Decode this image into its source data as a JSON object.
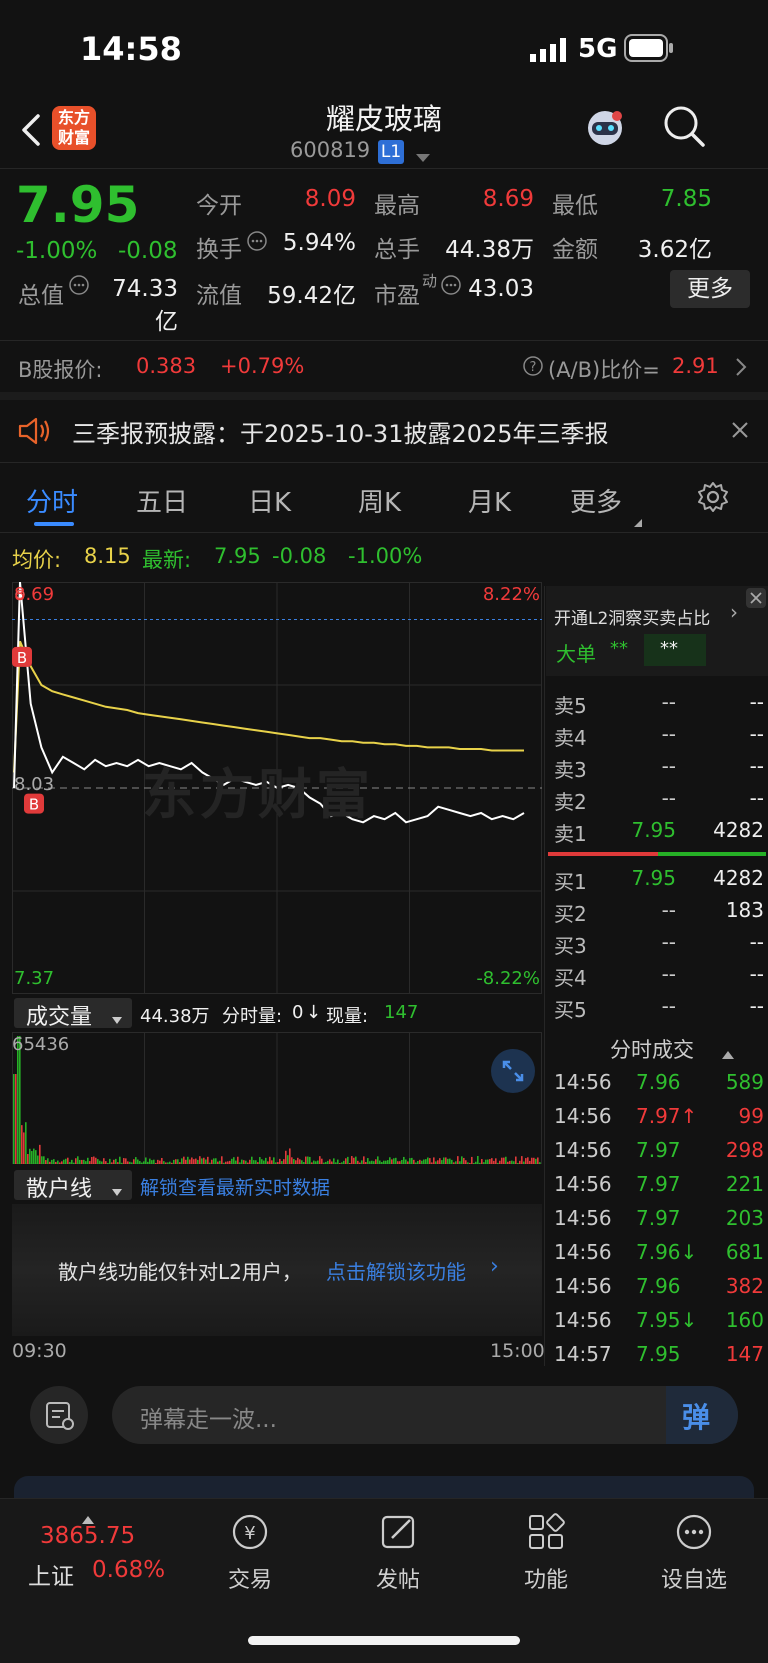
{
  "status": {
    "time": "14:58",
    "network": "5G"
  },
  "header": {
    "title": "耀皮玻璃",
    "code": "600819",
    "level": "L1",
    "logo_line1": "东方",
    "logo_line2": "财富"
  },
  "quote": {
    "price": "7.95",
    "change_pct": "-1.00%",
    "change": "-0.08",
    "row1": [
      {
        "label": "今开",
        "value": "8.09"
      },
      {
        "label": "最高",
        "value": "8.69"
      },
      {
        "label": "最低",
        "value": "7.85"
      }
    ],
    "row2": [
      {
        "label": "换手",
        "value": "5.94%"
      },
      {
        "label": "总手",
        "value": "44.38万"
      },
      {
        "label": "金额",
        "value": "3.62亿"
      }
    ],
    "row3": [
      {
        "label": "总值",
        "value": "74.33亿"
      },
      {
        "label": "流值",
        "value": "59.42亿"
      },
      {
        "label": "市盈",
        "sup": "动",
        "value": "43.03"
      }
    ],
    "more_button": "更多"
  },
  "b_share": {
    "label": "B股报价:",
    "price": "0.383",
    "change": "+0.79%",
    "ratio_label": "(A/B)比价=",
    "ratio": "2.91"
  },
  "notice": {
    "text": "三季报预披露：于2025-10-31披露2025年三季报"
  },
  "tabs": [
    "分时",
    "五日",
    "日K",
    "周K",
    "月K",
    "更多"
  ],
  "chart_header": {
    "avg_label": "均价:",
    "avg": "8.15",
    "latest_label": "最新:",
    "latest": "7.95",
    "change": "-0.08",
    "change_pct": "-1.00%"
  },
  "chart_data": {
    "type": "line",
    "y_left_ticks": [
      "8.69",
      "8.03",
      "7.37"
    ],
    "y_right_ticks": [
      "8.22%",
      "-8.22%"
    ],
    "ylim": [
      7.37,
      8.69
    ],
    "x_ticks": [
      "09:30",
      "15:00"
    ],
    "series": [
      {
        "name": "最新",
        "color": "#ffffff",
        "values": [
          8.03,
          8.69,
          8.3,
          8.16,
          8.08,
          8.13,
          8.11,
          8.09,
          8.12,
          8.1,
          8.11,
          8.1,
          8.12,
          8.1,
          8.11,
          8.1,
          8.09,
          8.11,
          8.08,
          8.06,
          8.04,
          8.06,
          8.05,
          8.04,
          8.05,
          8.03,
          8.04,
          8.03,
          8.0,
          7.98,
          7.94,
          7.95,
          7.93,
          7.92,
          7.94,
          7.93,
          7.95,
          7.92,
          7.93,
          7.94,
          7.97,
          7.96,
          7.95,
          7.94,
          7.95,
          7.93,
          7.94,
          7.93,
          7.95
        ]
      },
      {
        "name": "均价",
        "color": "#e8d24a",
        "values": [
          8.08,
          8.5,
          8.42,
          8.36,
          8.34,
          8.33,
          8.32,
          8.31,
          8.3,
          8.29,
          8.285,
          8.28,
          8.27,
          8.265,
          8.26,
          8.255,
          8.25,
          8.245,
          8.24,
          8.235,
          8.23,
          8.225,
          8.22,
          8.215,
          8.21,
          8.205,
          8.2,
          8.195,
          8.19,
          8.19,
          8.185,
          8.18,
          8.18,
          8.175,
          8.175,
          8.17,
          8.17,
          8.165,
          8.165,
          8.16,
          8.16,
          8.16,
          8.155,
          8.155,
          8.155,
          8.15,
          8.15,
          8.15,
          8.15
        ]
      }
    ],
    "markers": [
      {
        "label": "B",
        "index": 1
      },
      {
        "label": "B",
        "index": 3
      }
    ],
    "volume": {
      "label": "成交量",
      "total": "44.38万",
      "period_label": "分时量:",
      "period": "0",
      "now_label": "现量:",
      "now": "147",
      "max_tick": "65436"
    }
  },
  "watermark": "东方财富",
  "retail_line": {
    "label": "散户线",
    "unlock_link": "解锁查看最新实时数据",
    "message": "散户线功能仅针对L2用户，",
    "message_link": "点击解锁该功能"
  },
  "orderbook": {
    "promo": "开通L2洞察买卖占比",
    "big_order_label": "大单",
    "big_order_v1": "**",
    "big_order_v2": "**",
    "sells": [
      {
        "label": "卖5",
        "price": "--",
        "vol": "--"
      },
      {
        "label": "卖4",
        "price": "--",
        "vol": "--"
      },
      {
        "label": "卖3",
        "price": "--",
        "vol": "--"
      },
      {
        "label": "卖2",
        "price": "--",
        "vol": "--"
      },
      {
        "label": "卖1",
        "price": "7.95",
        "vol": "4282"
      }
    ],
    "buys": [
      {
        "label": "买1",
        "price": "7.95",
        "vol": "4282"
      },
      {
        "label": "买2",
        "price": "--",
        "vol": "183"
      },
      {
        "label": "买3",
        "price": "--",
        "vol": "--"
      },
      {
        "label": "买4",
        "price": "--",
        "vol": "--"
      },
      {
        "label": "买5",
        "price": "--",
        "vol": "--"
      }
    ]
  },
  "trades": {
    "title": "分时成交",
    "rows": [
      {
        "time": "14:56",
        "price": "7.96",
        "vol": "589",
        "color": "green"
      },
      {
        "time": "14:56",
        "price": "7.97↑",
        "vol": "99",
        "color": "red"
      },
      {
        "time": "14:56",
        "price": "7.97",
        "vol": "298",
        "color": "red"
      },
      {
        "time": "14:56",
        "price": "7.97",
        "vol": "221",
        "color": "green"
      },
      {
        "time": "14:56",
        "price": "7.97",
        "vol": "203",
        "color": "green"
      },
      {
        "time": "14:56",
        "price": "7.96↓",
        "vol": "681",
        "color": "green"
      },
      {
        "time": "14:56",
        "price": "7.96",
        "vol": "382",
        "color": "red"
      },
      {
        "time": "14:56",
        "price": "7.95↓",
        "vol": "160",
        "color": "green"
      },
      {
        "time": "14:57",
        "price": "7.95",
        "vol": "147",
        "color": "red"
      }
    ]
  },
  "danmaku": {
    "placeholder": "弹幕走一波...",
    "button": "弹"
  },
  "index": {
    "value": "3865.75",
    "name": "上证",
    "change": "0.68%"
  },
  "tabbar": [
    "交易",
    "发帖",
    "功能",
    "设自选"
  ]
}
